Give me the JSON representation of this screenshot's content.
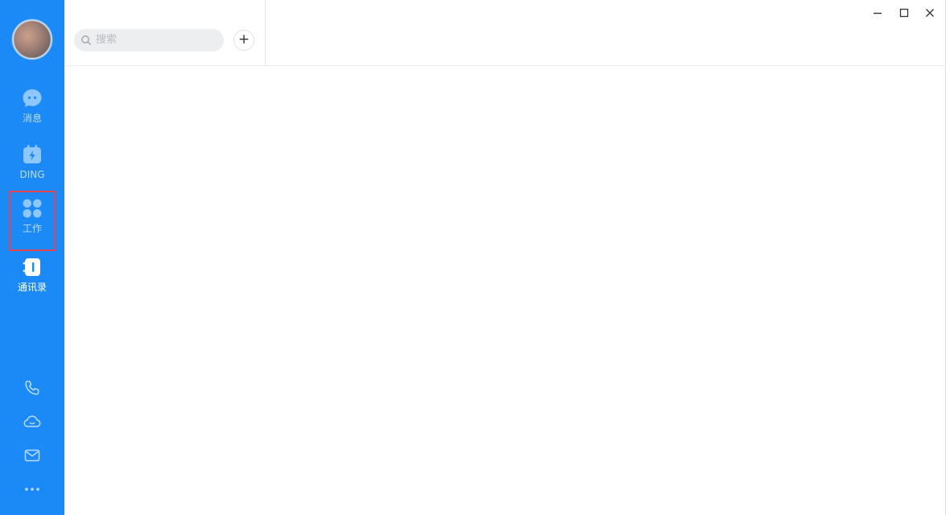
{
  "sidebar": {
    "nav": [
      {
        "label": "消息",
        "icon": "message-bubble-icon"
      },
      {
        "label": "DING",
        "icon": "ding-calendar-icon"
      },
      {
        "label": "工作",
        "icon": "workbench-grid-icon"
      },
      {
        "label": "通讯录",
        "icon": "contacts-book-icon"
      }
    ],
    "tools": [
      "phone-icon",
      "cloud-icon",
      "mail-icon",
      "more-dots-icon"
    ]
  },
  "search": {
    "placeholder": "搜索",
    "add_label": "+"
  },
  "window_controls": [
    "minimize-icon",
    "maximize-icon",
    "close-icon"
  ],
  "colors": {
    "sidebar_bg": "#1b8af7",
    "nav_label_inactive": "#bcdcff",
    "nav_label_active": "#ffffff",
    "highlight_box": "#e8424f"
  }
}
